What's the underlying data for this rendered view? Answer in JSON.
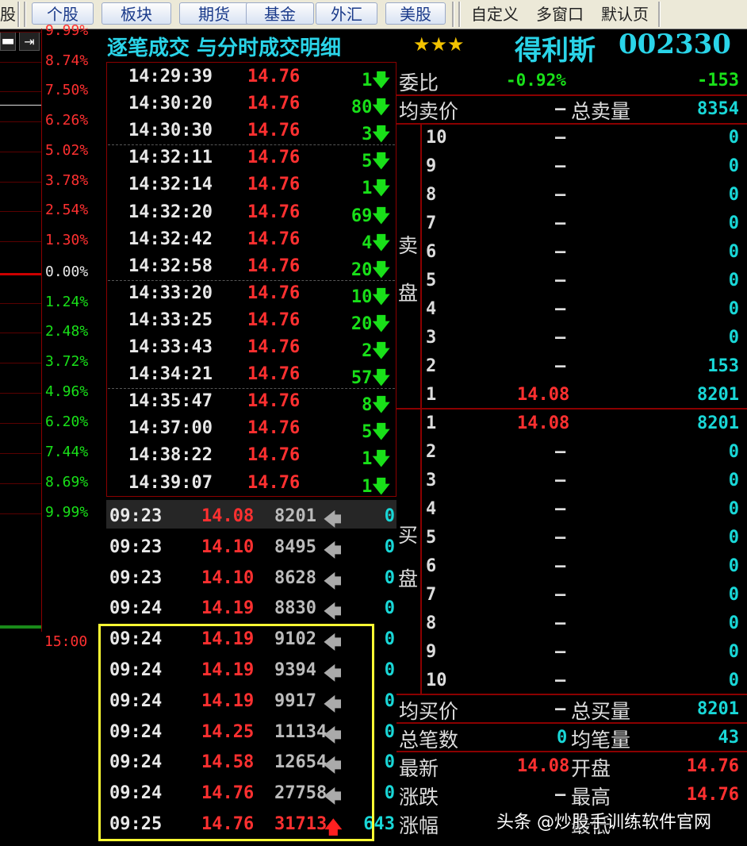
{
  "toolbar": {
    "partial_tab": "股",
    "tabs": [
      "个股",
      "板块",
      "期货",
      "基金",
      "外汇",
      "美股"
    ],
    "right_tabs": [
      "自定义",
      "多窗口",
      "默认页"
    ]
  },
  "left_scale": {
    "top_icons": [
      "minus-icon",
      "skip-end-icon"
    ],
    "levels": [
      "9.99%",
      "8.74%",
      "7.50%",
      "6.26%",
      "5.02%",
      "3.78%",
      "2.54%",
      "1.30%",
      "0.00%",
      "1.24%",
      "2.48%",
      "3.72%",
      "4.96%",
      "6.20%",
      "7.44%",
      "8.69%",
      "9.99%"
    ],
    "level_colors": [
      "#ff3030",
      "#ff3030",
      "#ff3030",
      "#ff3030",
      "#ff3030",
      "#ff3030",
      "#ff3030",
      "#ff3030",
      "#e8e8e8",
      "#19e019",
      "#19e019",
      "#19e019",
      "#19e019",
      "#19e019",
      "#19e019",
      "#19e019",
      "#19e019"
    ],
    "time_label": "15:00"
  },
  "header": {
    "title": "逐笔成交 与分时成交明细",
    "stars": "★★★",
    "stock_name": "得利斯",
    "stock_code": "002330"
  },
  "ticks": [
    {
      "time": "14:29:39",
      "price": "14.76",
      "vol": "1"
    },
    {
      "time": "14:30:20",
      "price": "14.76",
      "vol": "80"
    },
    {
      "time": "14:30:30",
      "price": "14.76",
      "vol": "3"
    },
    {
      "time": "14:32:11",
      "price": "14.76",
      "vol": "5"
    },
    {
      "time": "14:32:14",
      "price": "14.76",
      "vol": "1"
    },
    {
      "time": "14:32:20",
      "price": "14.76",
      "vol": "69"
    },
    {
      "time": "14:32:42",
      "price": "14.76",
      "vol": "4"
    },
    {
      "time": "14:32:58",
      "price": "14.76",
      "vol": "20"
    },
    {
      "time": "14:33:20",
      "price": "14.76",
      "vol": "10"
    },
    {
      "time": "14:33:25",
      "price": "14.76",
      "vol": "20"
    },
    {
      "time": "14:33:43",
      "price": "14.76",
      "vol": "2"
    },
    {
      "time": "14:34:21",
      "price": "14.76",
      "vol": "57"
    },
    {
      "time": "14:35:47",
      "price": "14.76",
      "vol": "8"
    },
    {
      "time": "14:37:00",
      "price": "14.76",
      "vol": "5"
    },
    {
      "time": "14:38:22",
      "price": "14.76",
      "vol": "1"
    },
    {
      "time": "14:39:07",
      "price": "14.76",
      "vol": "1"
    }
  ],
  "tick_arrow": "🡇",
  "auction": [
    {
      "time": "09:23",
      "price": "14.08",
      "qty": "8201",
      "arrow": "🡄",
      "val": "0"
    },
    {
      "time": "09:23",
      "price": "14.10",
      "qty": "8495",
      "arrow": "🡄",
      "val": "0"
    },
    {
      "time": "09:23",
      "price": "14.10",
      "qty": "8628",
      "arrow": "🡄",
      "val": "0"
    },
    {
      "time": "09:24",
      "price": "14.19",
      "qty": "8830",
      "arrow": "🡄",
      "val": "0"
    },
    {
      "time": "09:24",
      "price": "14.19",
      "qty": "9102",
      "arrow": "🡄",
      "val": "0"
    },
    {
      "time": "09:24",
      "price": "14.19",
      "qty": "9394",
      "arrow": "🡄",
      "val": "0"
    },
    {
      "time": "09:24",
      "price": "14.19",
      "qty": "9917",
      "arrow": "🡄",
      "val": "0"
    },
    {
      "time": "09:24",
      "price": "14.25",
      "qty": "11134",
      "arrow": "🡄",
      "val": "0"
    },
    {
      "time": "09:24",
      "price": "14.58",
      "qty": "12654",
      "arrow": "🡄",
      "val": "0"
    },
    {
      "time": "09:24",
      "price": "14.76",
      "qty": "27758",
      "arrow": "🡄",
      "val": "0"
    },
    {
      "time": "09:25",
      "price": "14.76",
      "qty": "31713",
      "arrow": "🡅",
      "val": "643"
    }
  ],
  "book": {
    "weibi_label": "委比",
    "weibi_pct": "-0.92%",
    "weibi_diff": "-153",
    "avg_ask_label": "均卖价",
    "avg_ask_val": "–",
    "total_ask_label": "总卖量",
    "total_ask_val": "8354",
    "sell_side_label": [
      "卖",
      "盘"
    ],
    "asks": [
      {
        "lvl": "10",
        "price": "–",
        "vol": "0"
      },
      {
        "lvl": "9",
        "price": "–",
        "vol": "0"
      },
      {
        "lvl": "8",
        "price": "–",
        "vol": "0"
      },
      {
        "lvl": "7",
        "price": "–",
        "vol": "0"
      },
      {
        "lvl": "6",
        "price": "–",
        "vol": "0"
      },
      {
        "lvl": "5",
        "price": "–",
        "vol": "0"
      },
      {
        "lvl": "4",
        "price": "–",
        "vol": "0"
      },
      {
        "lvl": "3",
        "price": "–",
        "vol": "0"
      },
      {
        "lvl": "2",
        "price": "–",
        "vol": "153"
      },
      {
        "lvl": "1",
        "price": "14.08",
        "vol": "8201"
      }
    ],
    "buy_side_label": [
      "买",
      "盘"
    ],
    "bids": [
      {
        "lvl": "1",
        "price": "14.08",
        "vol": "8201"
      },
      {
        "lvl": "2",
        "price": "–",
        "vol": "0"
      },
      {
        "lvl": "3",
        "price": "–",
        "vol": "0"
      },
      {
        "lvl": "4",
        "price": "–",
        "vol": "0"
      },
      {
        "lvl": "5",
        "price": "–",
        "vol": "0"
      },
      {
        "lvl": "6",
        "price": "–",
        "vol": "0"
      },
      {
        "lvl": "7",
        "price": "–",
        "vol": "0"
      },
      {
        "lvl": "8",
        "price": "–",
        "vol": "0"
      },
      {
        "lvl": "9",
        "price": "–",
        "vol": "0"
      },
      {
        "lvl": "10",
        "price": "–",
        "vol": "0"
      }
    ],
    "avg_bid_label": "均买价",
    "avg_bid_val": "–",
    "total_bid_label": "总买量",
    "total_bid_val": "8201",
    "total_trades_label": "总笔数",
    "total_trades_val": "0",
    "avg_trade_label": "均笔量",
    "avg_trade_val": "43",
    "latest_label": "最新",
    "latest_val": "14.08",
    "open_label": "开盘",
    "open_val": "14.76",
    "change_label": "涨跌",
    "change_val": "–",
    "high_label": "最高",
    "high_val": "14.76",
    "change_pct_label": "涨幅",
    "low_label": "最低"
  },
  "watermark": "头条 @炒股手训练软件官网",
  "colors": {
    "up": "#ff3030",
    "down": "#19e019",
    "cyan": "#19d7d7",
    "title_cyan": "#2ad4e8",
    "gold": "#f2c200",
    "highlight_box": "#ffff33"
  }
}
